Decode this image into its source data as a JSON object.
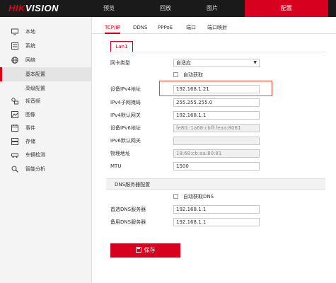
{
  "brand": {
    "name_red": "HIKVISION"
  },
  "nav": [
    "预览",
    "回放",
    "图片",
    "配置"
  ],
  "sidebar": [
    {
      "label": "本地",
      "icon": "monitor-icon"
    },
    {
      "label": "系统",
      "icon": "system-icon"
    },
    {
      "label": "网络",
      "icon": "globe-icon"
    },
    {
      "label": "基本配置",
      "icon": ""
    },
    {
      "label": "高级配置",
      "icon": ""
    },
    {
      "label": "视音频",
      "icon": "audio-video-icon"
    },
    {
      "label": "图像",
      "icon": "image-icon"
    },
    {
      "label": "事件",
      "icon": "calendar-icon"
    },
    {
      "label": "存储",
      "icon": "storage-icon"
    },
    {
      "label": "车辆检测",
      "icon": "vehicle-icon"
    },
    {
      "label": "智能分析",
      "icon": "analysis-icon"
    }
  ],
  "tabs": [
    "TCP/IP",
    "DDNS",
    "PPPoE",
    "端口",
    "端口映射"
  ],
  "lan_tab": "Lan1",
  "form": {
    "nic_type": {
      "label": "网卡类型",
      "value": "自适应"
    },
    "dhcp": {
      "label": "自动获取"
    },
    "ipv4": {
      "label": "设备IPv4地址",
      "value": "192.168.1.21"
    },
    "mask": {
      "label": "IPv4子网掩码",
      "value": "255.255.255.0"
    },
    "gw4": {
      "label": "IPv4默认网关",
      "value": "192.168.1.1"
    },
    "ipv6": {
      "label": "设备IPv6地址",
      "value": "fe80::1a68:cbff:feaa:8081"
    },
    "gw6": {
      "label": "IPv6默认网关",
      "value": ""
    },
    "mac": {
      "label": "物理地址",
      "value": "18:68:cb:aa:80:81"
    },
    "mtu": {
      "label": "MTU",
      "value": "1500"
    }
  },
  "dns": {
    "title": "DNS服务器配置",
    "auto": "自动获取DNS",
    "primary": {
      "label": "首选DNS服务器",
      "value": "192.168.1.1"
    },
    "backup": {
      "label": "备用DNS服务器",
      "value": "192.168.1.1"
    }
  },
  "save_label": "保存",
  "colors": {
    "accent": "#d7001f",
    "highlight": "#e64a3b"
  }
}
